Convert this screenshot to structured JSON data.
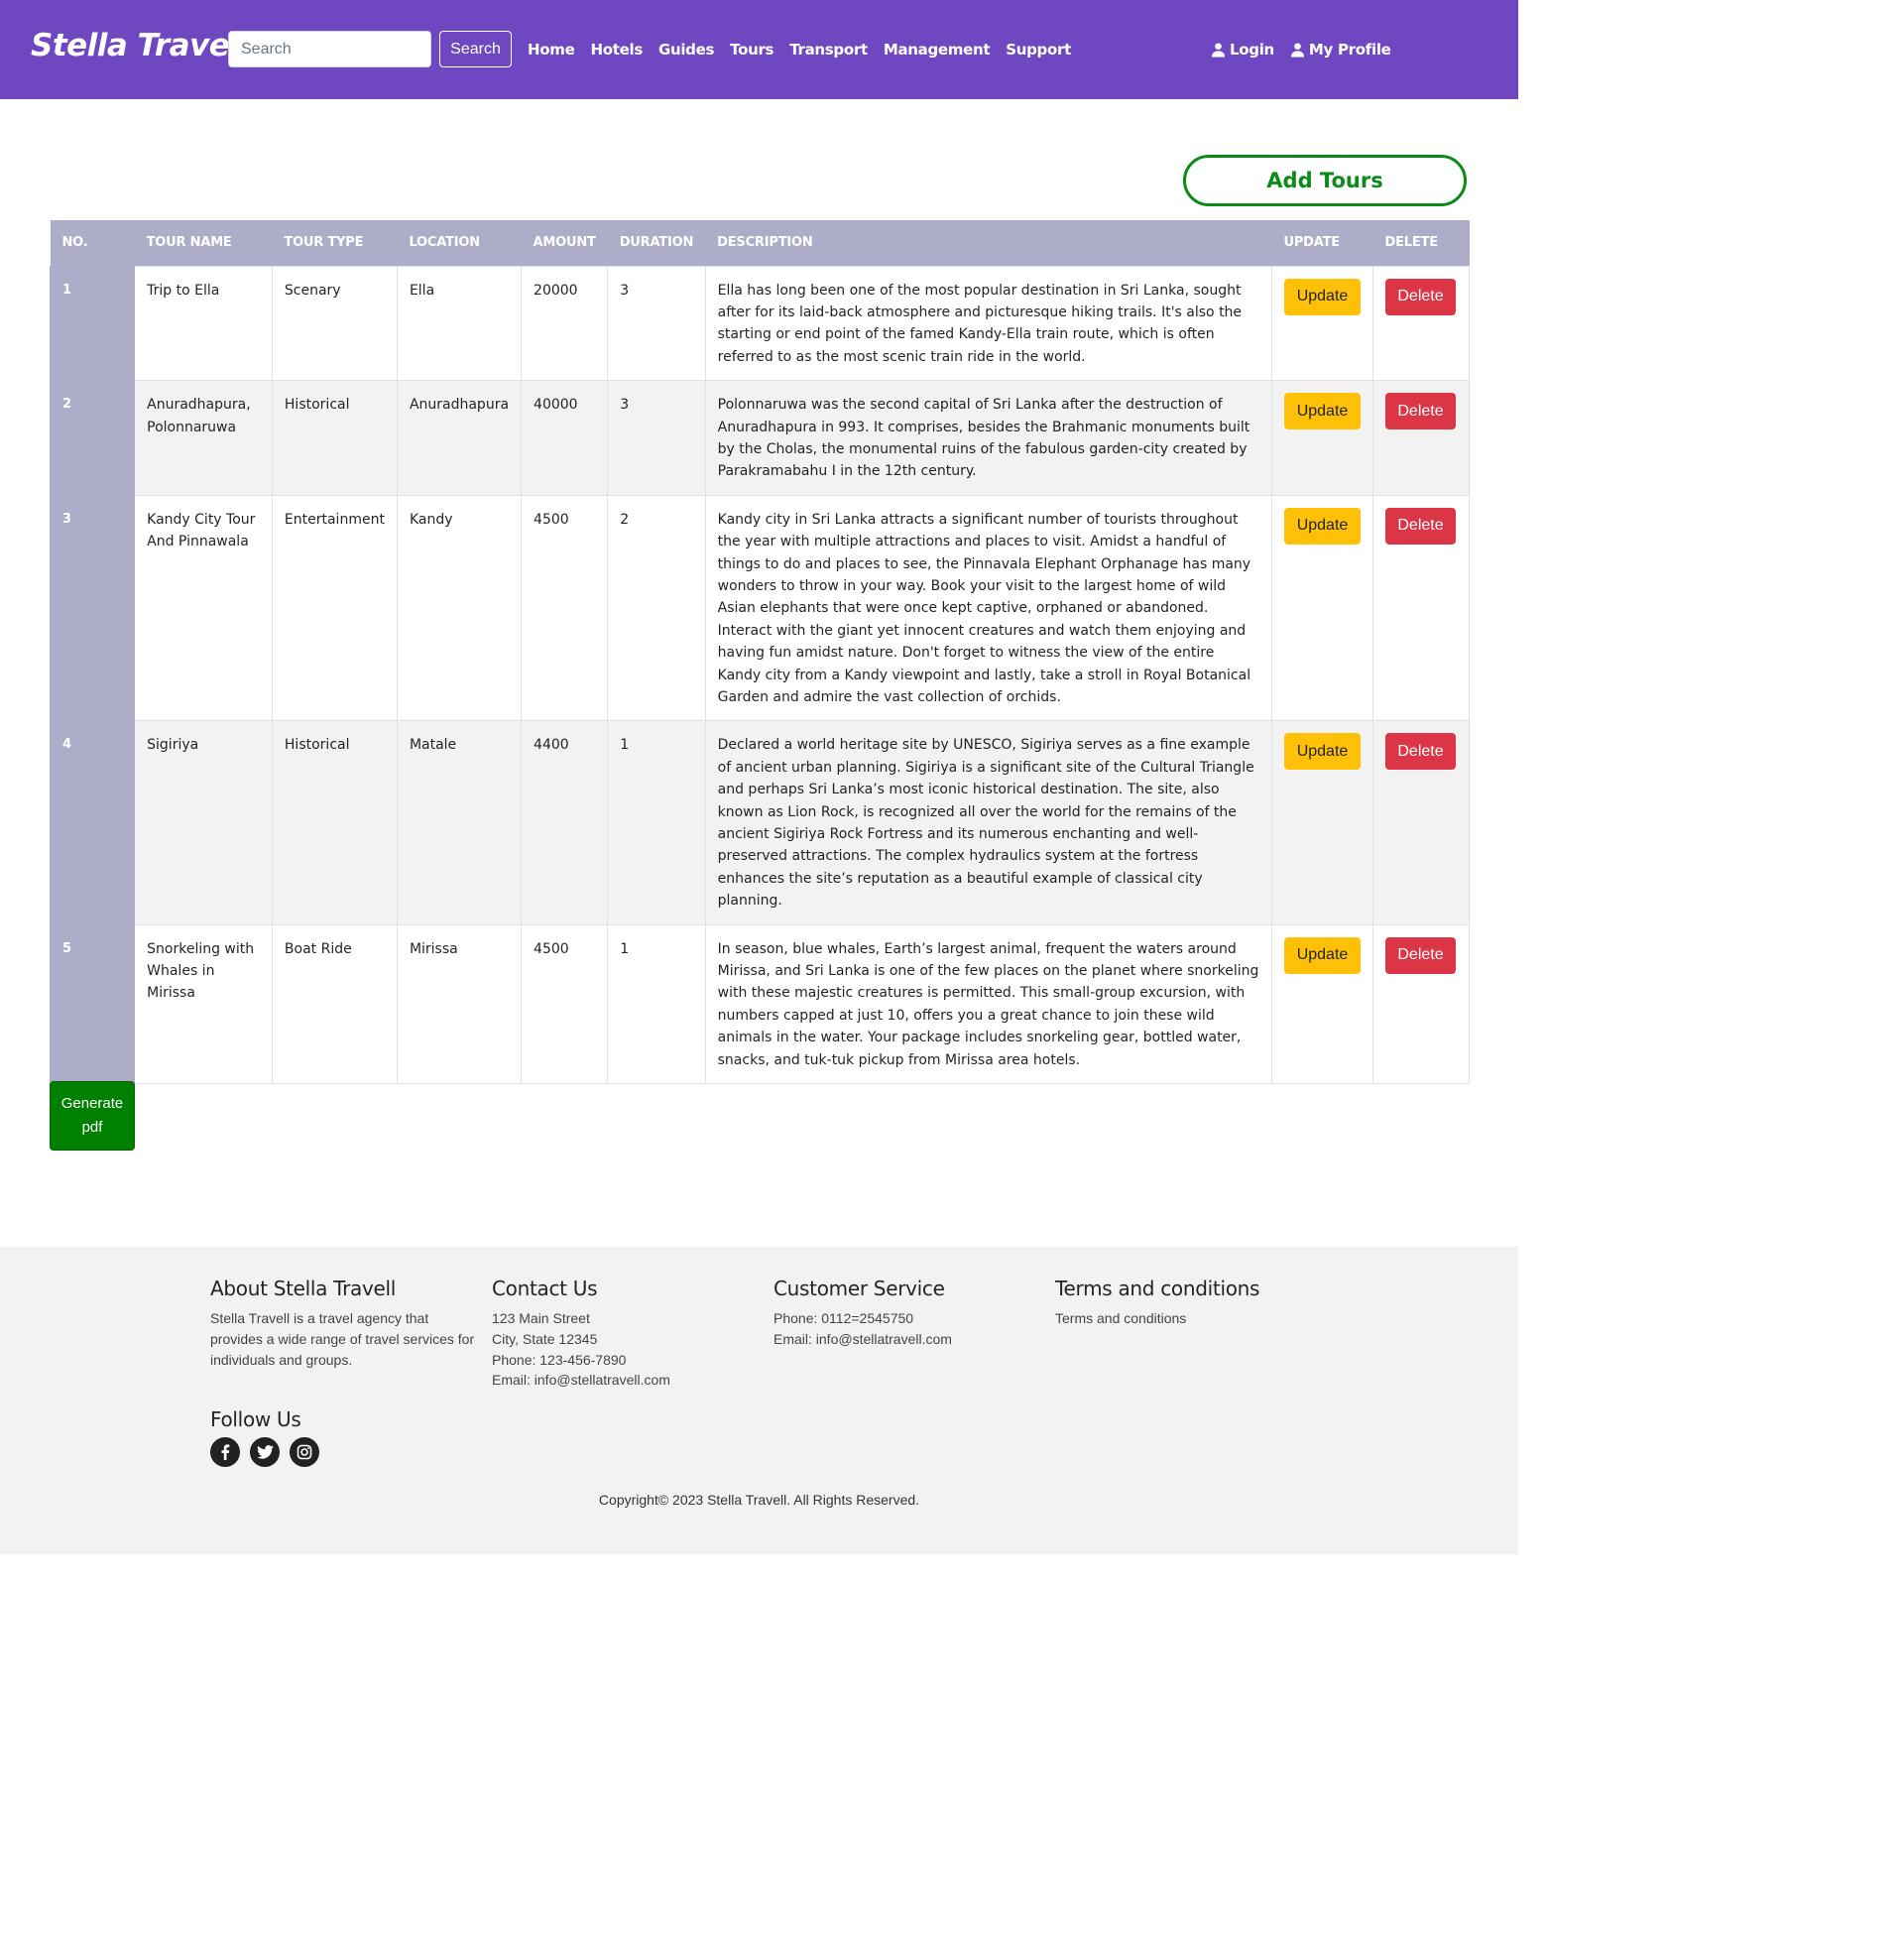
{
  "nav": {
    "brand": "Stella Travel",
    "search_placeholder": "Search",
    "search_button": "Search",
    "links": [
      "Home",
      "Hotels",
      "Guides",
      "Tours",
      "Transport",
      "Management",
      "Support"
    ],
    "login": "Login",
    "profile": "My Profile"
  },
  "main": {
    "add_tours": "Add Tours",
    "generate_pdf": "Generate pdf",
    "columns": [
      "No.",
      "Tour Name",
      "Tour Type",
      "Location",
      "Amount",
      "Duration",
      "Description",
      "Update",
      "Delete"
    ],
    "update_label": "Update",
    "delete_label": "Delete",
    "rows": [
      {
        "no": "1",
        "name": "Trip to Ella",
        "type": "Scenary",
        "location": "Ella",
        "amount": "20000",
        "duration": "3",
        "description": "Ella has long been one of the most popular destination in Sri Lanka, sought after for its laid-back atmosphere and picturesque hiking trails. It's also the starting or end point of the famed Kandy-Ella train route, which is often referred to as the most scenic train ride in the world."
      },
      {
        "no": "2",
        "name": "Anuradhapura, Polonnaruwa",
        "type": "Historical",
        "location": "Anuradhapura",
        "amount": "40000",
        "duration": "3",
        "description": "Polonnaruwa was the second capital of Sri Lanka after the destruction of Anuradhapura in 993. It comprises, besides the Brahmanic monuments built by the Cholas, the monumental ruins of the fabulous garden-city created by Parakramabahu I in the 12th century."
      },
      {
        "no": "3",
        "name": "Kandy City Tour And Pinnawala",
        "type": "Entertainment",
        "location": "Kandy",
        "amount": "4500",
        "duration": "2",
        "description": "Kandy city in Sri Lanka attracts a significant number of tourists throughout the year with multiple attractions and places to visit. Amidst a handful of things to do and places to see, the Pinnavala Elephant Orphanage has many wonders to throw in your way. Book your visit to the largest home of wild Asian elephants that were once kept captive, orphaned or abandoned. Interact with the giant yet innocent creatures and watch them enjoying and having fun amidst nature. Don't forget to witness the view of the entire Kandy city from a Kandy viewpoint and lastly, take a stroll in Royal Botanical Garden and admire the vast collection of orchids."
      },
      {
        "no": "4",
        "name": "Sigiriya",
        "type": "Historical",
        "location": "Matale",
        "amount": "4400",
        "duration": "1",
        "description": "Declared a world heritage site by UNESCO, Sigiriya serves as a fine example of ancient urban planning. Sigiriya is a significant site of the Cultural Triangle and perhaps Sri Lanka’s most iconic historical destination. The site, also known as Lion Rock, is recognized all over the world for the remains of the ancient Sigiriya Rock Fortress and its numerous enchanting and well-preserved attractions. The complex hydraulics system at the fortress enhances the site’s reputation as a beautiful example of classical city planning."
      },
      {
        "no": "5",
        "name": "Snorkeling with Whales in Mirissa",
        "type": "Boat Ride",
        "location": "Mirissa",
        "amount": "4500",
        "duration": "1",
        "description": "In season, blue whales, Earth’s largest animal, frequent the waters around Mirissa, and Sri Lanka is one of the few places on the planet where snorkeling with these majestic creatures is permitted. This small-group excursion, with numbers capped at just 10, offers you a great chance to join these wild animals in the water. Your package includes snorkeling gear, bottled water, snacks, and tuk-tuk pickup from Mirissa area hotels."
      }
    ]
  },
  "footer": {
    "about_title": "About Stella Travell",
    "about_text": "Stella Travell is a travel agency that provides a wide range of travel services for individuals and groups.",
    "contact_title": "Contact Us",
    "contact_lines": [
      "123 Main Street",
      "City, State 12345",
      "Phone: 123-456-7890",
      "Email: info@stellatravell.com"
    ],
    "service_title": "Customer Service",
    "service_lines": [
      "Phone: 0112=2545750",
      "Email: info@stellatravell.com"
    ],
    "terms_title": "Terms and conditions",
    "terms_link": "Terms and conditions",
    "follow_title": "Follow Us",
    "social": [
      "facebook-icon",
      "twitter-icon",
      "instagram-icon"
    ],
    "copyright": "Copyright© 2023 Stella Travell. All Rights Reserved."
  },
  "colors": {
    "navbar": "#6f47c1",
    "table_header": "#adadc9",
    "update": "#ffc107",
    "delete": "#dc3545",
    "add_tours": "#0a8a16",
    "generate_pdf": "#008000",
    "footer_bg": "#f2f2f2"
  }
}
